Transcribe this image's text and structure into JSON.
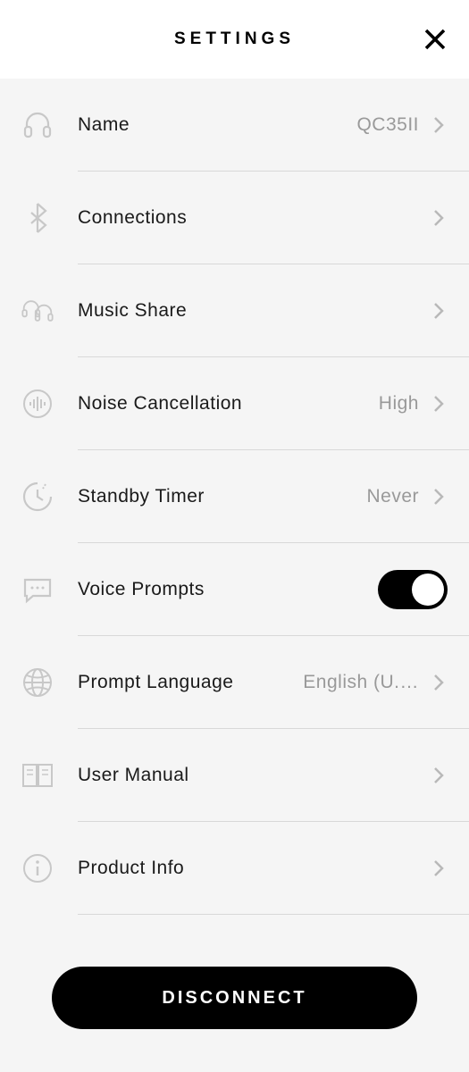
{
  "header": {
    "title": "SETTINGS"
  },
  "items": {
    "name": {
      "label": "Name",
      "value": "QC35II"
    },
    "connections": {
      "label": "Connections"
    },
    "musicShare": {
      "label": "Music Share"
    },
    "noiseCancellation": {
      "label": "Noise Cancellation",
      "value": "High"
    },
    "standbyTimer": {
      "label": "Standby Timer",
      "value": "Never"
    },
    "voicePrompts": {
      "label": "Voice Prompts",
      "enabled": true
    },
    "promptLanguage": {
      "label": "Prompt Language",
      "value": "English (U.…"
    },
    "userManual": {
      "label": "User Manual"
    },
    "productInfo": {
      "label": "Product Info"
    }
  },
  "disconnect": {
    "label": "DISCONNECT"
  }
}
